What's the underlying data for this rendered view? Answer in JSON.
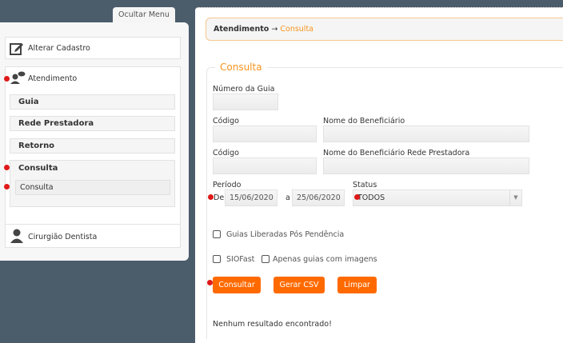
{
  "sidebar": {
    "toggle_label": "Ocultar Menu",
    "items": [
      {
        "label": "Alterar Cadastro",
        "icon": "edit-icon"
      },
      {
        "label": "Atendimento",
        "icon": "user-chat-icon",
        "children": [
          "Guia",
          "Rede Prestadora",
          "Retorno"
        ],
        "expanded": {
          "label": "Consulta",
          "children": [
            "Consulta"
          ]
        }
      },
      {
        "label": "Cirurgião Dentista",
        "icon": "user-icon"
      }
    ]
  },
  "breadcrumb": {
    "parent": "Atendimento",
    "separator": "→",
    "current": "Consulta"
  },
  "form": {
    "legend": "Consulta",
    "numero_guia_label": "Número da Guia",
    "numero_guia_value": "",
    "codigo_label": "Código",
    "nome_beneficiario_label": "Nome do Beneficiário",
    "codigo2_label": "Código",
    "nome_beneficiario_rede_label": "Nome do Beneficiário Rede Prestadora",
    "periodo_label": "Período",
    "de_label": "De",
    "date_from": "15/06/2020",
    "a_label": "a",
    "date_to": "25/06/2020",
    "status_label": "Status",
    "status_value": "TODOS",
    "checkbox_liberadas": "Guias Liberadas Pós Pendência",
    "checkbox_siofast": "SIOFast",
    "checkbox_imagens": "Apenas guias com imagens",
    "buttons": {
      "consultar": "Consultar",
      "gerar_csv": "Gerar CSV",
      "limpar": "Limpar"
    },
    "accent_color": "#ff6a00"
  },
  "result_message": "Nenhum resultado encontrado!"
}
